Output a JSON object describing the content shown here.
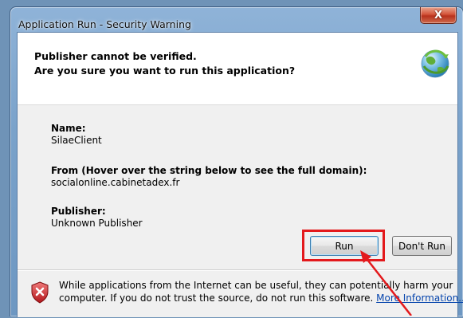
{
  "window": {
    "title": "Application Run - Security Warning",
    "close_label": "X"
  },
  "header": {
    "line1": "Publisher cannot be verified.",
    "line2": "Are you sure you want to run this application?",
    "icon": "globe-icon"
  },
  "details": {
    "name_label": "Name:",
    "name_value": "SilaeClient",
    "from_label": "From (Hover over the string below to see the full domain):",
    "from_value": "socialonline.cabinetadex.fr",
    "publisher_label": "Publisher:",
    "publisher_value": "Unknown Publisher"
  },
  "buttons": {
    "run_label": "Run",
    "dont_run_label": "Don't Run"
  },
  "footer": {
    "line1": "While applications from the Internet can be useful, they can potentially harm your",
    "line2_prefix": "computer. If you do not trust the source, do not run this software.",
    "link_label": "More Information...",
    "icon": "shield-warning-icon"
  },
  "annotation": {
    "highlight_color": "#e3191c",
    "arrow_color": "#e3191c"
  }
}
